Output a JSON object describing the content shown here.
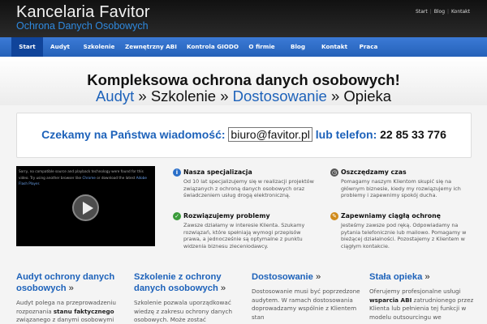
{
  "header": {
    "title": "Kancelaria Favitor",
    "subtitle": "Ochrona Danych Osobowych",
    "top_links": [
      "Start",
      "Blog",
      "Kontakt"
    ]
  },
  "nav": {
    "items": [
      "Start",
      "Audyt",
      "Szkolenie",
      "Zewnętrzny ABI",
      "Kontrola GIODO",
      "O firmie",
      "Blog",
      "Kontakt",
      "Praca"
    ],
    "active": "Start"
  },
  "hero": {
    "title": "Kompleksowa ochrona danych osobowych!",
    "sub_1": "Audyt",
    "sep_1": " » ",
    "sub_2": "Szkolenie",
    "sep_2": " » ",
    "sub_3": "Dostosowanie",
    "sep_3": " » ",
    "sub_4": "Opieka"
  },
  "contact": {
    "lead": "Czekamy na Państwa wiadomość: ",
    "email": "biuro@favitor.pl",
    "mid": " lub telefon: ",
    "phone": "22 85 33 776"
  },
  "video": {
    "msg_1": "Sorry, no compatible source and playback technology were found for this video. Try using another browser like ",
    "link_chrome": "Chrome",
    "msg_2": " or download the latest ",
    "link_flash": "Adobe Flash Player",
    "msg_3": "."
  },
  "features": [
    {
      "title": "Nasza specjalizacja",
      "icon": "info-icon",
      "color": "#2a6fc9",
      "text": "Od 10 lat specjalizujemy się w realizacji projektów związanych z ochroną danych osobowych oraz świadczeniem usług drogą elektroniczną."
    },
    {
      "title": "Oszczędzamy czas",
      "icon": "clock-icon",
      "color": "#555555",
      "text": "Pomagamy naszym Klientom skupić się na głównym biznesie, kiedy my rozwiązujemy ich problemy i zapewnimy spokój ducha."
    },
    {
      "title": "Rozwiązujemy problemy",
      "icon": "check-icon",
      "color": "#3a9b3a",
      "text": "Zawsze działamy w interesie Klienta. Szukamy rozwiązań, które spełniają wymogi przepisów prawa, a jednocześnie są optymalne z punktu widzenia biznesu zleceniodawcy."
    },
    {
      "title": "Zapewniamy ciągłą ochronę",
      "icon": "pencil-icon",
      "color": "#d08a1a",
      "text": "Jesteśmy zawsze pod ręką. Odpowiadamy na pytania telefonicznie lub mailowo. Pomagamy w bieżącej działalności. Pozostajemy z Klientem w ciągłym kontakcie."
    }
  ],
  "columns": [
    {
      "title": "Audyt ochrony danych osobowych",
      "raquo": " »",
      "t1": "Audyt polega na przeprowadzeniu rozpoznania ",
      "b": "stanu faktycznego",
      "t2": " związanego z danymi osobowymi"
    },
    {
      "title": "Szkolenie z ochrony danych osobowych",
      "raquo": " »",
      "t1": "Szkolenie pozwala uporządkować wiedzę z zakresu ochrony danych osobowych. Może zostać",
      "b": "",
      "t2": ""
    },
    {
      "title": "Dostosowanie",
      "raquo": " »",
      "t1": "Dostosowanie musi być poprzedzone audytem. W ramach dostosowania doprowadzamy wspólnie z Klientem stan",
      "b": "",
      "t2": ""
    },
    {
      "title": "Stała opieka",
      "raquo": " »",
      "t1": "Oferujemy profesjonalne usługi ",
      "b": "wsparcia ABI",
      "t2": " zatrudnionego przez Klienta lub pełnienia tej funkcji w modelu outsourcingu we"
    }
  ]
}
